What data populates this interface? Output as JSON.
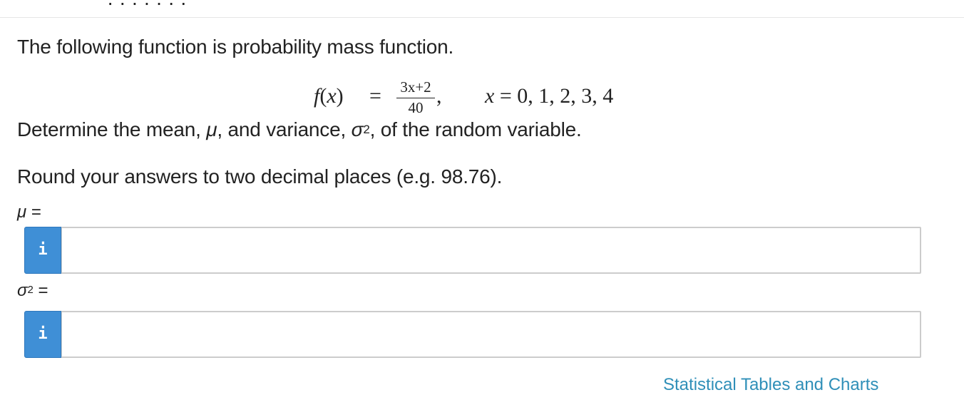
{
  "header": {
    "clipped_text": "· · · · · · ·"
  },
  "question": {
    "intro": "The following function is probability mass function.",
    "equation": {
      "lhs_f": "f",
      "lhs_open": "(",
      "lhs_x": "x",
      "lhs_close": ")",
      "equals": "=",
      "numerator": "3x+2",
      "denominator": "40",
      "comma": ",",
      "domain_var": "x",
      "domain_values": " = 0, 1, 2, 3, 4"
    },
    "determine": {
      "part1": "Determine the mean, ",
      "mu": "μ",
      "part2": ", and variance, ",
      "sigma": "σ",
      "sigma_exp": "2",
      "part3": ", of the random variable."
    },
    "rounding": "Round your answers to two decimal places (e.g. 98.76)."
  },
  "answers": {
    "mu_label_sym": "μ",
    "mu_label_eq": " =",
    "mu_value": "",
    "sigma_label_sym": "σ",
    "sigma_label_exp": "2",
    "sigma_label_eq": " =",
    "sigma_value": "",
    "info_glyph": "i",
    "info_icon": "info-icon"
  },
  "footer": {
    "clipped_link": "Statistical Tables and Charts"
  },
  "colors": {
    "info_button": "#3f8fd6",
    "input_border": "#cccccc",
    "text": "#222222",
    "link": "#2f8fb8"
  }
}
